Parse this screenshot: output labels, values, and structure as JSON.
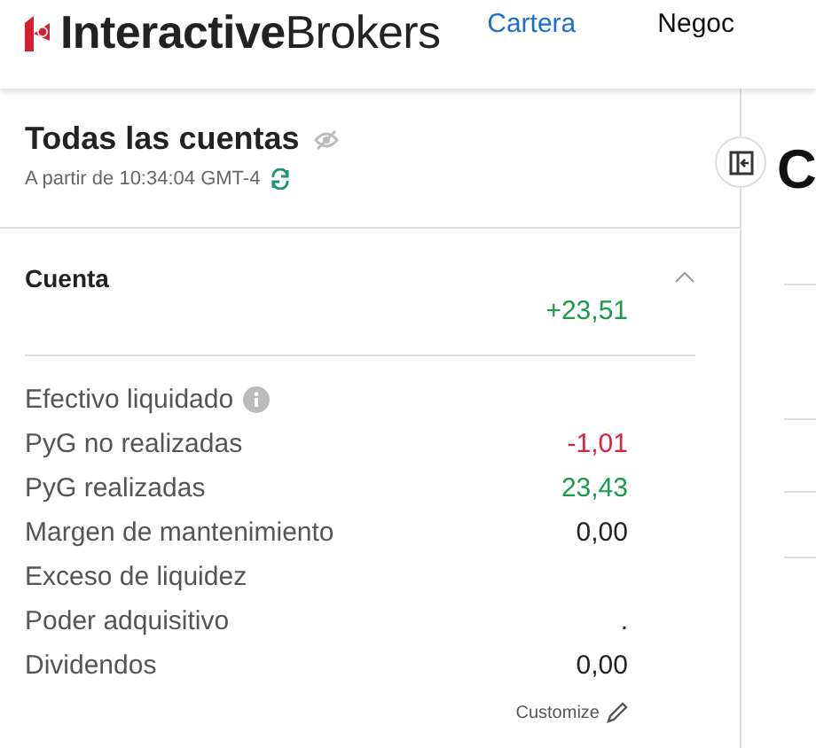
{
  "header": {
    "logo": "**Interactive**Brokers",
    "nav": [
      {
        "label": "Cartera",
        "selected": true
      },
      {
        "label": "Negoc",
        "selected": false
      }
    ]
  },
  "summary": {
    "title": "Todas las cuentas",
    "timestamp": "A partir de 10:34:04 GMT-4",
    "section": {
      "title": "Cuenta",
      "expanded": true,
      "total": {
        "value": "+23,51",
        "color": "#1a9a4b"
      }
    },
    "rows": [
      {
        "label": "Efectivo liquidado",
        "info": true
      },
      {
        "label": "PyG no realizadas",
        "info": false,
        "value": "-1,01",
        "color": "#e0203a"
      },
      {
        "label": "PyG realizadas",
        "info": false,
        "value": "23,43",
        "color": "#1a9a4b"
      },
      {
        "label": "Margen de mantenimiento",
        "info": false,
        "value": "0,00",
        "color": "#222222"
      },
      {
        "label": "Exceso de liquidez",
        "info": false
      },
      {
        "label": "Poder adquisitivo",
        "info": false,
        "value": ".",
        "color": "#222222"
      },
      {
        "label": "Dividendos",
        "info": false,
        "value": "0,00",
        "color": "#222222"
      }
    ],
    "customize": "Customize"
  },
  "main": {
    "heading": "C"
  }
}
